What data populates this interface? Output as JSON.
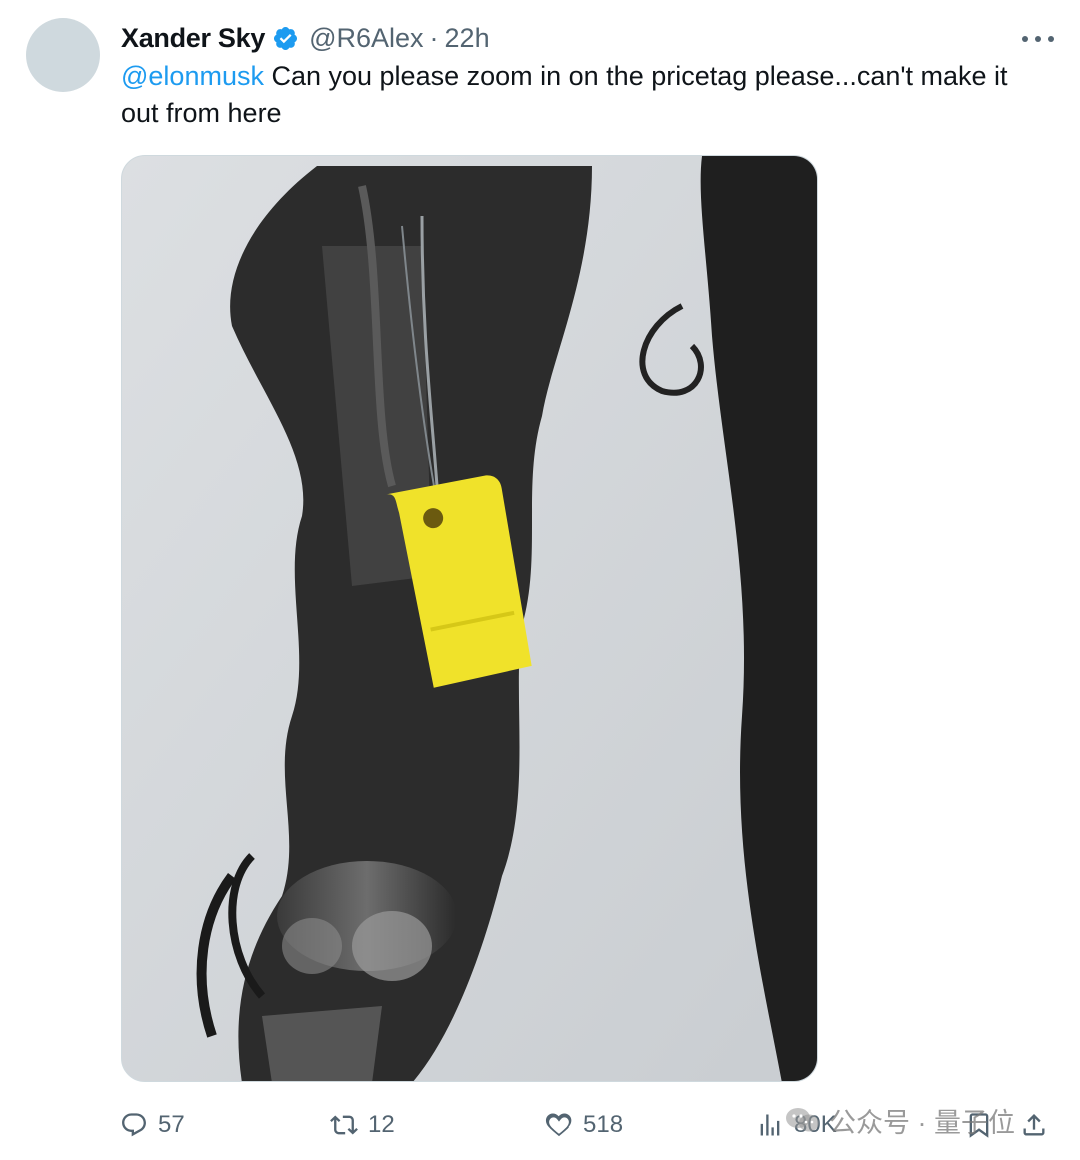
{
  "tweet": {
    "author": {
      "display_name": "Xander Sky",
      "handle": "@R6Alex",
      "separator": "·",
      "time": "22h"
    },
    "text": {
      "mention": "@elonmusk",
      "body": " Can you please zoom in on the pricetag please...can't make it out from here"
    },
    "media": {
      "description_colors": {
        "tag": "#f0e22a",
        "background": "#d6d9dc"
      }
    },
    "actions": {
      "replies": "57",
      "reposts": "12",
      "likes": "518",
      "views": "80K"
    }
  },
  "watermark": {
    "text": "公众号 · 量子位"
  },
  "colors": {
    "accent": "#1d9bf0",
    "secondary_text": "#536471",
    "primary_text": "#0f1419"
  },
  "icons": [
    "verified-badge-icon",
    "more-icon",
    "reply-icon",
    "repost-icon",
    "like-icon",
    "views-icon",
    "bookmark-icon",
    "share-icon",
    "wechat-logo-icon"
  ]
}
